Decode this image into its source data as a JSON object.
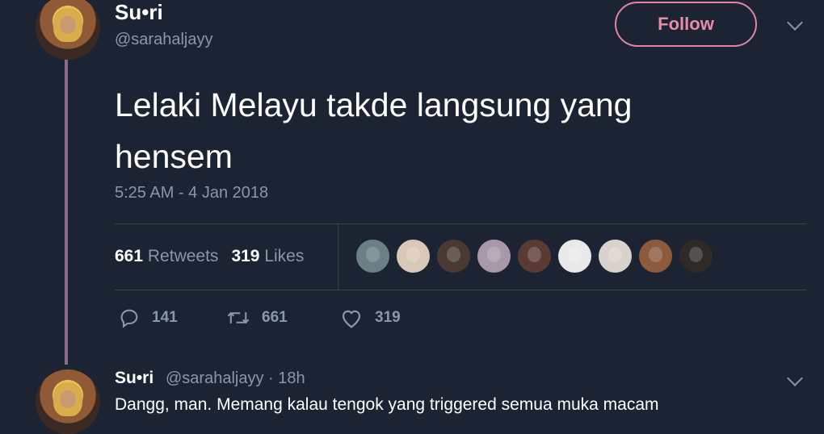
{
  "tweet": {
    "display_name": "Su•ri",
    "handle": "@sarahaljayy",
    "follow_label": "Follow",
    "text": "Lelaki Melayu takde langsung yang hensem",
    "timestamp": "5:25 AM - 4 Jan 2018",
    "stats": {
      "retweets_count": "661",
      "retweets_label": "Retweets",
      "likes_count": "319",
      "likes_label": "Likes"
    },
    "likers": [
      {
        "color": "#6b7f86"
      },
      {
        "color": "#d9c8b8"
      },
      {
        "color": "#4b3a33"
      },
      {
        "color": "#a899a8"
      },
      {
        "color": "#5a3b33"
      },
      {
        "color": "#e9e9ea"
      },
      {
        "color": "#d8d2cc"
      },
      {
        "color": "#8e5a3d"
      },
      {
        "color": "#2f2a26"
      }
    ],
    "actions": {
      "reply_count": "141",
      "retweet_count": "661",
      "like_count": "319"
    }
  },
  "reply": {
    "display_name": "Su•ri",
    "meta": "@sarahaljayy · 18h",
    "text": "Dangg, man. Memang kalau tengok yang triggered semua muka macam"
  },
  "icons": {
    "reply": "reply-icon",
    "retweet": "retweet-icon",
    "like": "heart-icon",
    "more": "chevron-down-icon"
  },
  "colors": {
    "background": "#1c2433",
    "follow_accent": "#e0879f",
    "muted_text": "#8899a6",
    "thread_line": "#8b6a8b"
  }
}
